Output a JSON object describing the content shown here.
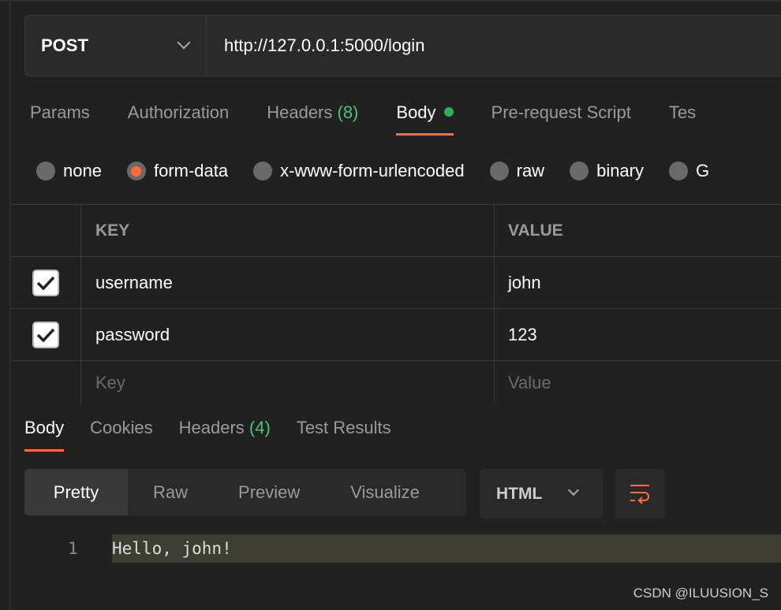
{
  "request": {
    "method": "POST",
    "url": "http://127.0.0.1:5000/login"
  },
  "tabs": [
    {
      "label": "Params"
    },
    {
      "label": "Authorization"
    },
    {
      "label": "Headers",
      "count": "(8)"
    },
    {
      "label": "Body"
    },
    {
      "label": "Pre-request Script"
    },
    {
      "label": "Tes"
    }
  ],
  "body_types": [
    "none",
    "form-data",
    "x-www-form-urlencoded",
    "raw",
    "binary",
    "G"
  ],
  "table": {
    "headers": [
      "KEY",
      "VALUE"
    ],
    "rows": [
      {
        "key": "username",
        "value": "john",
        "checked": true
      },
      {
        "key": "password",
        "value": "123",
        "checked": true
      }
    ],
    "placeholders": {
      "key": "Key",
      "value": "Value"
    }
  },
  "response": {
    "tabs": [
      {
        "label": "Body"
      },
      {
        "label": "Cookies"
      },
      {
        "label": "Headers",
        "count": "(4)"
      },
      {
        "label": "Test Results"
      }
    ],
    "views": [
      "Pretty",
      "Raw",
      "Preview",
      "Visualize"
    ],
    "format": "HTML",
    "lines": [
      {
        "n": "1",
        "text": "Hello, john!"
      }
    ]
  },
  "watermark": "CSDN @ILUUSION_S",
  "colors": {
    "accent": "#ff6c37",
    "green": "#4dc37a"
  }
}
